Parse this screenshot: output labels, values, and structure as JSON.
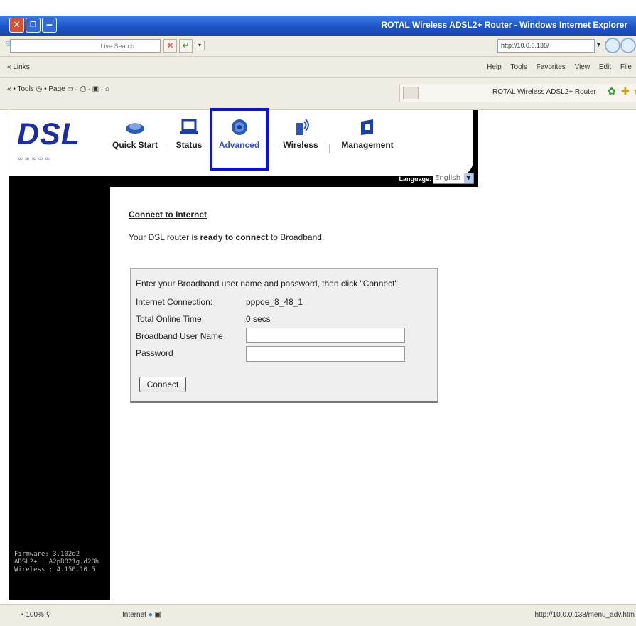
{
  "window": {
    "title": "ROTAL Wireless ADSL2+ Router - Windows Internet Explorer"
  },
  "browser": {
    "search_placeholder": "Live Search",
    "address": "http://10.0.0.138/",
    "links_label": "Links",
    "menu": [
      "Help",
      "Tools",
      "Favorites",
      "View",
      "Edit",
      "File"
    ],
    "command_bar": [
      "Tools",
      "Page"
    ],
    "tab_label": "ROTAL Wireless ADSL2+ Router"
  },
  "router": {
    "logo": "DSL",
    "nav": [
      {
        "label": "Quick Start"
      },
      {
        "label": "Status"
      },
      {
        "label": "Advanced"
      },
      {
        "label": "Wireless"
      },
      {
        "label": "Management"
      }
    ],
    "language_label": "Language:",
    "language_value": "English",
    "firmware": [
      "Firmware: 3.102d2",
      "ADSL2+ : A2pB021g.d20h",
      "Wireless : 4.150.10.5"
    ]
  },
  "connect": {
    "title": "Connect to Internet",
    "ready_prefix": "Your DSL router is",
    "ready_bold": "ready to connect",
    "ready_suffix": "to Broadband.",
    "instruction": "Enter your Broadband user name and password, then click \"Connect\".",
    "fields": {
      "internet_connection_label": "Internet Connection:",
      "internet_connection_value": "pppoe_8_48_1",
      "online_time_label": "Total Online Time:",
      "online_time_value": "0 secs",
      "user_label": "Broadband User Name",
      "password_label": "Password"
    },
    "button": "Connect"
  },
  "status": {
    "zoom": "100%",
    "zone": "Internet",
    "url": "http://10.0.0.138/menu_adv.htm"
  }
}
